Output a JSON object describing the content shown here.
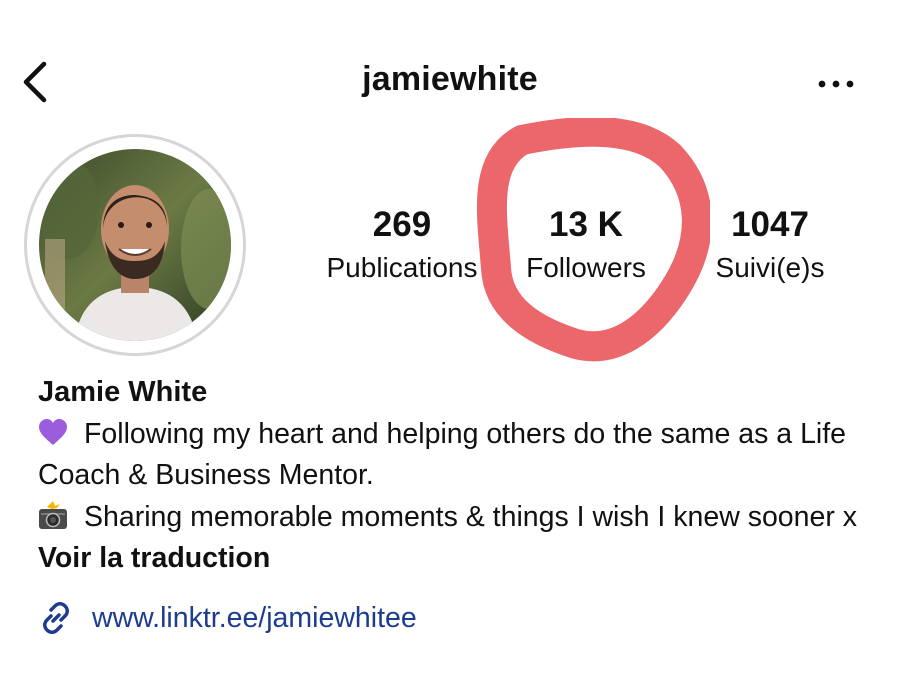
{
  "header": {
    "username": "jamiewhite",
    "back_icon": "chevron-left-icon",
    "more_icon": "more-horizontal-icon"
  },
  "profile": {
    "avatar_icon": "profile-photo"
  },
  "stats": [
    {
      "value": "269",
      "label": "Publications"
    },
    {
      "value": "13 K",
      "label": "Followers"
    },
    {
      "value": "1047",
      "label": "Suivi(e)s"
    }
  ],
  "bio": {
    "name": "Jamie White",
    "line1_emoji": "purple-heart-icon",
    "line1": "Following my heart and helping others do the same as a Life Coach & Business Mentor.",
    "line2_emoji": "camera-flash-icon",
    "line2": "Sharing memorable moments & things I wish I knew sooner x",
    "translate": "Voir la traduction",
    "link_icon": "link-icon",
    "link": "www.linktr.ee/jamiewhitee"
  },
  "colors": {
    "highlight": "#e8464b",
    "link": "#1d3c8f",
    "text": "#111111",
    "avatar_ring": "#d6d6d6"
  }
}
